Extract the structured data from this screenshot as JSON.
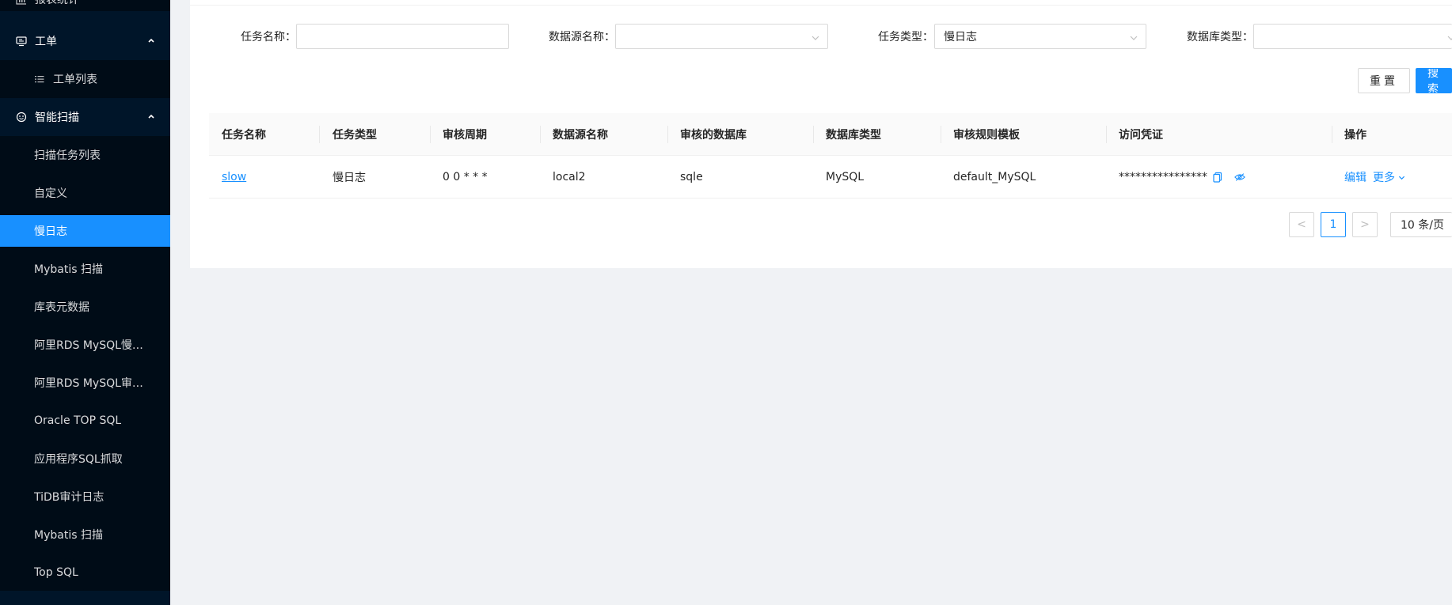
{
  "sidebar": {
    "partial_top": {
      "label": "报表统计",
      "icon": "bar-chart-icon"
    },
    "groups": [
      {
        "label": "工单",
        "icon": "monitor-icon",
        "expanded": true,
        "items": [
          {
            "label": "工单列表",
            "icon": "list-icon"
          }
        ]
      },
      {
        "label": "智能扫描",
        "icon": "scan-icon",
        "expanded": true,
        "items": [
          {
            "label": "扫描任务列表"
          },
          {
            "label": "自定义"
          },
          {
            "label": "慢日志",
            "active": true
          },
          {
            "label": "Mybatis 扫描"
          },
          {
            "label": "库表元数据"
          },
          {
            "label": "阿里RDS MySQL慢日志"
          },
          {
            "label": "阿里RDS MySQL审计..."
          },
          {
            "label": "Oracle TOP SQL"
          },
          {
            "label": "应用程序SQL抓取"
          },
          {
            "label": "TiDB审计日志"
          },
          {
            "label": "Mybatis 扫描"
          },
          {
            "label": "Top SQL"
          }
        ]
      }
    ]
  },
  "filters": {
    "task_name": {
      "label": "任务名称：",
      "value": ""
    },
    "datasource_name": {
      "label": "数据源名称：",
      "value": ""
    },
    "task_type": {
      "label": "任务类型：",
      "value": "慢日志"
    },
    "db_type": {
      "label": "数据库类型：",
      "value": ""
    },
    "reset_label": "重置",
    "search_label": "搜索"
  },
  "table": {
    "columns": [
      "任务名称",
      "任务类型",
      "审核周期",
      "数据源名称",
      "审核的数据库",
      "数据库类型",
      "审核规则模板",
      "访问凭证",
      "操作"
    ],
    "rows": [
      {
        "task_name": "slow",
        "task_type": "慢日志",
        "cycle": "0 0 * * *",
        "datasource": "local2",
        "database": "sqle",
        "db_type": "MySQL",
        "rule_template": "default_MySQL",
        "credential": "****************",
        "edit_label": "编辑",
        "more_label": "更多"
      }
    ]
  },
  "pagination": {
    "prev": "<",
    "current_page": "1",
    "next": ">",
    "page_size": "10 条/页"
  },
  "colors": {
    "sidebar_bg": "#001529",
    "sidebar_sub_bg": "#000c17",
    "accent": "#1890ff"
  }
}
